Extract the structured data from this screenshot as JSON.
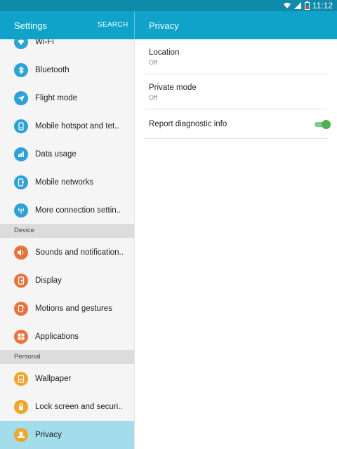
{
  "status_bar": {
    "time": "11:12",
    "icons": [
      "wifi-icon",
      "signal-icon",
      "battery-icon"
    ]
  },
  "header": {
    "left_title": "Settings",
    "search_label": "SEARCH",
    "right_title": "Privacy"
  },
  "sidebar": {
    "items": [
      {
        "label": "Wi-Fi",
        "icon": "wifi-icon",
        "color": "#2ea1d6"
      },
      {
        "label": "Bluetooth",
        "icon": "bluetooth-icon",
        "color": "#2ea1d6"
      },
      {
        "label": "Flight mode",
        "icon": "airplane-icon",
        "color": "#2ea1d6"
      },
      {
        "label": "Mobile hotspot and tet..",
        "icon": "hotspot-icon",
        "color": "#2ea1d6"
      },
      {
        "label": "Data usage",
        "icon": "data-usage-icon",
        "color": "#2ea1d6"
      },
      {
        "label": "Mobile networks",
        "icon": "mobile-networks-icon",
        "color": "#2ea1d6"
      },
      {
        "label": "More connection settin..",
        "icon": "more-connection-icon",
        "color": "#2ea1d6"
      },
      {
        "label": "Sounds and notification..",
        "icon": "sound-icon",
        "color": "#e8733a"
      },
      {
        "label": "Display",
        "icon": "display-icon",
        "color": "#e8733a"
      },
      {
        "label": "Motions and gestures",
        "icon": "motions-icon",
        "color": "#e8733a"
      },
      {
        "label": "Applications",
        "icon": "applications-icon",
        "color": "#e8733a"
      },
      {
        "label": "Wallpaper",
        "icon": "wallpaper-icon",
        "color": "#f0a52d"
      },
      {
        "label": "Lock screen and securi..",
        "icon": "lock-icon",
        "color": "#f0a52d"
      },
      {
        "label": "Privacy",
        "icon": "privacy-icon",
        "color": "#f0a52d"
      }
    ],
    "sections": {
      "device": "Device",
      "personal": "Personal"
    }
  },
  "privacy": {
    "location": {
      "title": "Location",
      "value": "Off"
    },
    "private_mode": {
      "title": "Private mode",
      "value": "Off"
    },
    "report": {
      "title": "Report diagnostic info",
      "enabled": true
    }
  },
  "colors": {
    "status_bar": "#0f8aa8",
    "app_bar": "#0fa3c9",
    "selected_row": "#a3dceb",
    "toggle_on": "#4caf50"
  }
}
